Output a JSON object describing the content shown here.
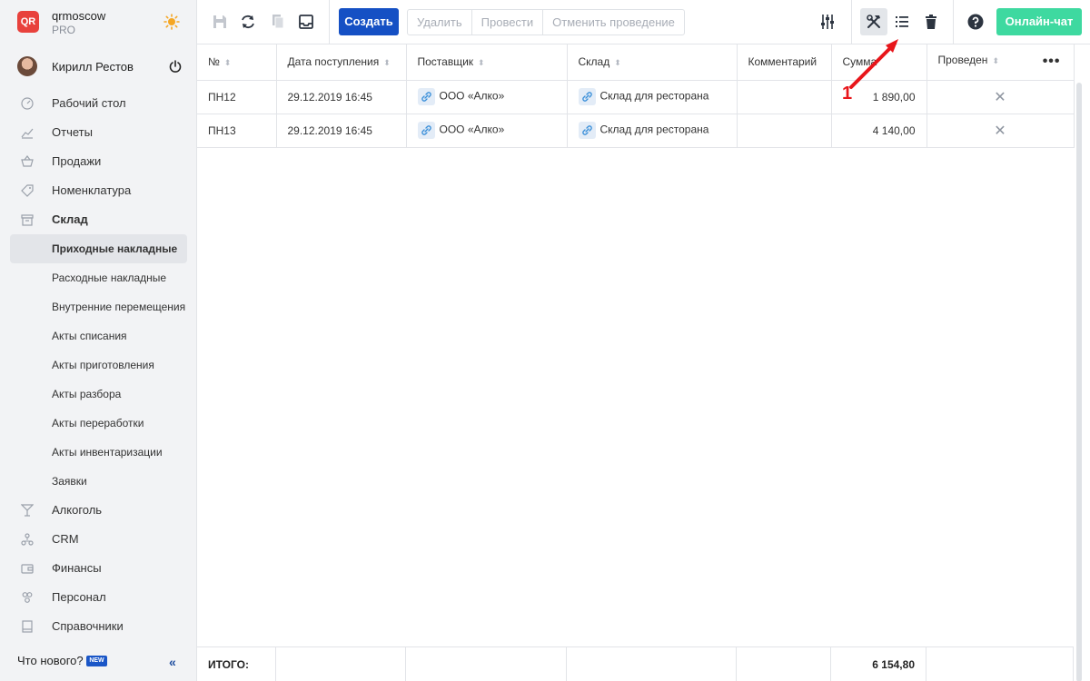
{
  "brand": {
    "logo_text": "QR",
    "name": "qrmoscow",
    "plan": "PRO"
  },
  "user": {
    "name": "Кирилл Рестов"
  },
  "nav": {
    "items_top": [
      {
        "label": "Рабочий стол",
        "icon": "dashboard-icon"
      },
      {
        "label": "Отчеты",
        "icon": "reports-icon"
      },
      {
        "label": "Продажи",
        "icon": "basket-icon"
      },
      {
        "label": "Номенклатура",
        "icon": "tag-icon"
      },
      {
        "label": "Склад",
        "icon": "box-icon"
      }
    ],
    "warehouse_sub": [
      "Приходные накладные",
      "Расходные накладные",
      "Внутренние перемещения",
      "Акты списания",
      "Акты приготовления",
      "Акты разбора",
      "Акты переработки",
      "Акты инвентаризации",
      "Заявки"
    ],
    "items_bottom": [
      {
        "label": "Алкоголь",
        "icon": "glass-icon"
      },
      {
        "label": "CRM",
        "icon": "crm-icon"
      },
      {
        "label": "Финансы",
        "icon": "wallet-icon"
      },
      {
        "label": "Персонал",
        "icon": "people-icon"
      },
      {
        "label": "Справочники",
        "icon": "book-icon"
      }
    ],
    "whats_new": "Что нового?",
    "new_badge": "NEW"
  },
  "toolbar": {
    "create": "Создать",
    "delete": "Удалить",
    "post": "Провести",
    "unpost": "Отменить проведение",
    "chat": "Онлайн-чат"
  },
  "table": {
    "headers": {
      "num": "№",
      "date": "Дата поступления",
      "supplier": "Поставщик",
      "warehouse": "Склад",
      "comment": "Комментарий",
      "sum": "Сумма",
      "posted": "Проведен"
    },
    "rows": [
      {
        "num": "ПН12",
        "date": "29.12.2019 16:45",
        "supplier": "ООО «Алко»",
        "warehouse": "Склад для ресторана",
        "comment": "",
        "sum": "1 890,00",
        "posted": "✕"
      },
      {
        "num": "ПН13",
        "date": "29.12.2019 16:45",
        "supplier": "ООО «Алко»",
        "warehouse": "Склад для ресторана",
        "comment": "",
        "sum": "4 140,00",
        "posted": "✕"
      }
    ],
    "total_label": "ИТОГО:",
    "total_value": "6 154,80"
  },
  "annotation": {
    "number": "1"
  },
  "colors": {
    "primary": "#1550c4",
    "chat": "#3ed9a0",
    "annotation": "#e8161b"
  }
}
